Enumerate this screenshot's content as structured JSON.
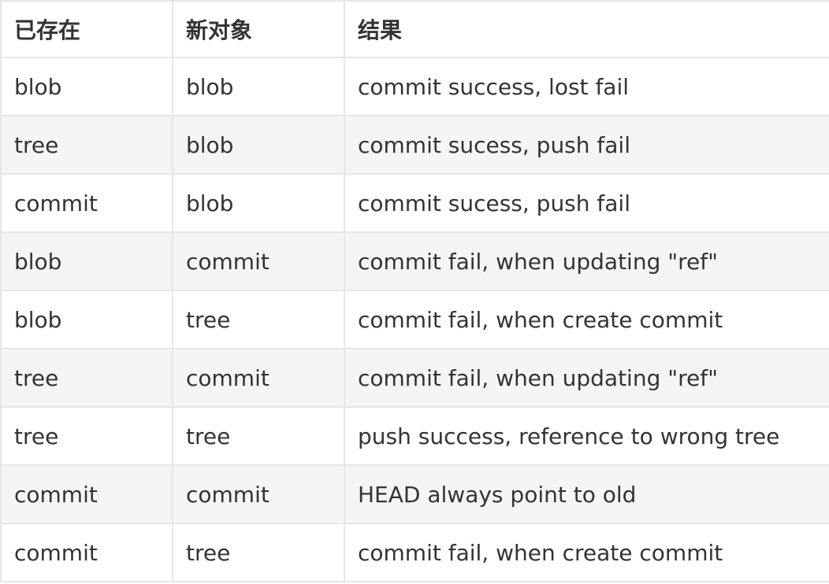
{
  "table": {
    "headers": [
      "已存在",
      "新对象",
      "结果"
    ],
    "rows": [
      [
        "blob",
        "blob",
        "commit success, lost fail"
      ],
      [
        "tree",
        "blob",
        "commit sucess, push fail"
      ],
      [
        "commit",
        "blob",
        "commit sucess, push fail"
      ],
      [
        "blob",
        "commit",
        "commit fail, when updating \"ref\""
      ],
      [
        "blob",
        "tree",
        "commit fail, when create commit"
      ],
      [
        "tree",
        "commit",
        "commit fail, when updating \"ref\""
      ],
      [
        "tree",
        "tree",
        "push success, reference to wrong tree"
      ],
      [
        "commit",
        "commit",
        "HEAD always point to old"
      ],
      [
        "commit",
        "tree",
        "commit fail, when create commit"
      ]
    ]
  },
  "colors": {
    "border": "#e6e6e6",
    "stripe": "#f5f5f5",
    "text": "#333333"
  }
}
